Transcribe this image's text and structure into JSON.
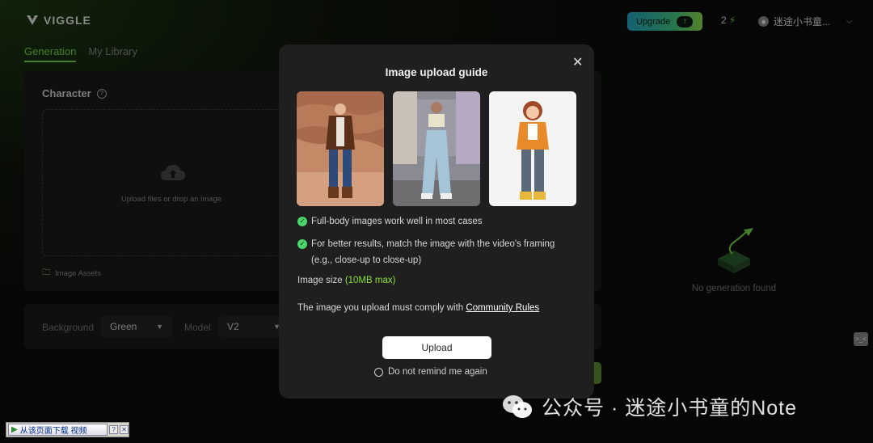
{
  "header": {
    "brand": "VIGGLE",
    "upgrade_label": "Upgrade",
    "credits": "2",
    "username": "迷途小书童..."
  },
  "tabs": [
    {
      "label": "Generation",
      "active": true
    },
    {
      "label": "My Library",
      "active": false
    }
  ],
  "character_panel": {
    "title": "Character",
    "upload_hint": "Upload files or drop an image",
    "assets_label": "Image Assets"
  },
  "settings": {
    "background_label": "Background",
    "background_value": "Green",
    "model_label": "Model",
    "model_value": "V2"
  },
  "empty_state": {
    "text": "No generation found"
  },
  "modal": {
    "title": "Image upload guide",
    "guide_images": [
      {
        "icon": "man-jacket-photo"
      },
      {
        "icon": "woman-street-photo"
      },
      {
        "icon": "cartoon-girl-render"
      }
    ],
    "tips": [
      {
        "text": "Full-body images work well in most cases"
      },
      {
        "text": "For better results, match the image with the video's framing",
        "text2": "(e.g., close-up to close-up)"
      }
    ],
    "size_label": "Image size",
    "size_limit": "(10MB max)",
    "comply_text": "The image you upload must comply with",
    "comply_link": "Community Rules",
    "upload_label": "Upload",
    "remind_label": "Do not remind me again"
  },
  "watermark": {
    "text": "公众号 · 迷途小书童的Note"
  },
  "download_bar": {
    "label": "从该页面下载 视频",
    "help": "?",
    "close": "✕"
  },
  "colors": {
    "accent_green": "#7ad94a",
    "check_green": "#4cd46a",
    "modal_bg": "#1f1f1f"
  }
}
